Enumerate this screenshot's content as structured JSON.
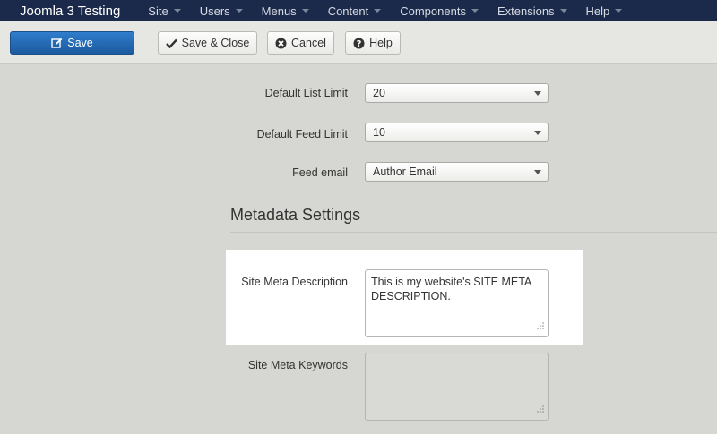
{
  "nav": {
    "brand": "Joomla 3 Testing",
    "items": [
      {
        "label": "Site"
      },
      {
        "label": "Users"
      },
      {
        "label": "Menus"
      },
      {
        "label": "Content"
      },
      {
        "label": "Components"
      },
      {
        "label": "Extensions"
      },
      {
        "label": "Help"
      }
    ]
  },
  "toolbar": {
    "save_label": "Save",
    "save_close_label": "Save & Close",
    "cancel_label": "Cancel",
    "help_label": "Help"
  },
  "form": {
    "list_limit": {
      "label": "Default List Limit",
      "value": "20"
    },
    "feed_limit": {
      "label": "Default Feed Limit",
      "value": "10"
    },
    "feed_email": {
      "label": "Feed email",
      "value": "Author Email"
    },
    "metadata": {
      "title": "Metadata Settings",
      "description": {
        "label": "Site Meta Description",
        "value": "This is my website's SITE META DESCRIPTION."
      },
      "keywords": {
        "label": "Site Meta Keywords",
        "value": ""
      }
    }
  },
  "colors": {
    "navbar": "#1b2a4a",
    "primary_button": "#2a6fb8",
    "background": "#d6d7d2",
    "highlight": "#ffffff"
  },
  "icons": {
    "save": "edit-icon",
    "save_close": "checkmark-icon",
    "cancel": "cancel-circle-icon",
    "help": "help-circle-icon"
  }
}
